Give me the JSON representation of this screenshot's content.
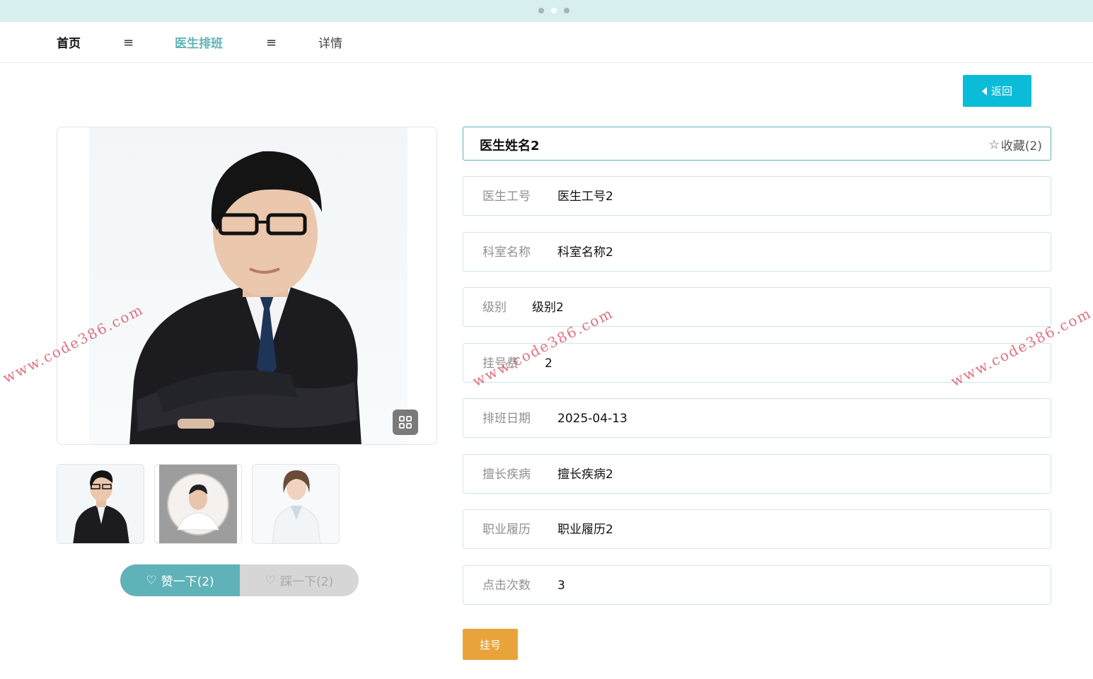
{
  "breadcrumb": {
    "home": "首页",
    "separator": "≡",
    "schedule": "医生排班",
    "detail": "详情"
  },
  "back_label": "返回",
  "doctor": {
    "name": "医生姓名2",
    "favorite": "收藏(2)"
  },
  "fields": [
    {
      "label": "医生工号",
      "value": "医生工号2"
    },
    {
      "label": "科室名称",
      "value": "科室名称2"
    },
    {
      "label": "级别",
      "value": "级别2"
    },
    {
      "label": "挂号费",
      "value": "2"
    },
    {
      "label": "排班日期",
      "value": "2025-04-13"
    },
    {
      "label": "擅长疾病",
      "value": "擅长疾病2"
    },
    {
      "label": "职业履历",
      "value": "职业履历2"
    },
    {
      "label": "点击次数",
      "value": "3"
    }
  ],
  "vote": {
    "like": "赞一下(2)",
    "dislike": "踩一下(2)"
  },
  "register_label": "挂号",
  "watermark": "www.code386.com",
  "colors": {
    "accent": "#5fb3b8",
    "back_button": "#0bbcd8",
    "register_button": "#e8a43a",
    "topbar": "#d8eff0"
  }
}
